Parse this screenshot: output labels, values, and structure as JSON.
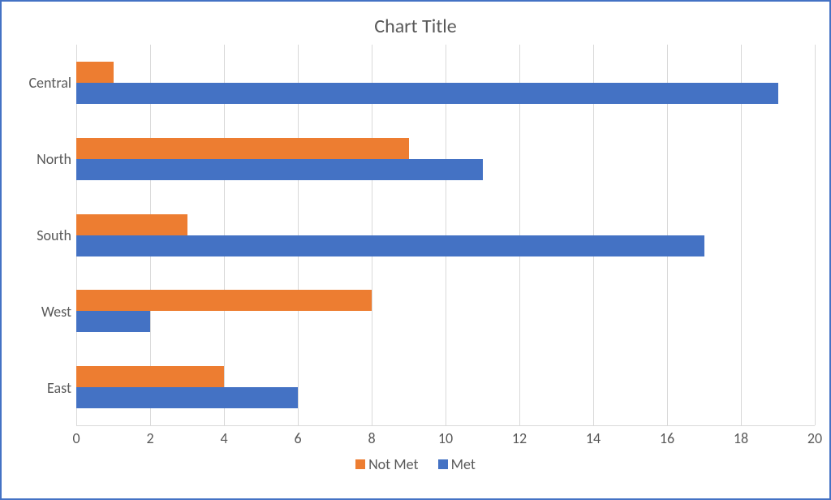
{
  "chart_data": {
    "type": "bar",
    "orientation": "horizontal",
    "title": "Chart Title",
    "categories": [
      "Central",
      "North",
      "South",
      "West",
      "East"
    ],
    "series": [
      {
        "name": "Not Met",
        "values": [
          1,
          9,
          3,
          8,
          4
        ],
        "color": "#ed7d31"
      },
      {
        "name": "Met",
        "values": [
          19,
          11,
          17,
          2,
          6
        ],
        "color": "#4472c4"
      }
    ],
    "xlabel": "",
    "ylabel": "",
    "xlim": [
      0,
      20
    ],
    "x_ticks": [
      0,
      2,
      4,
      6,
      8,
      10,
      12,
      14,
      16,
      18,
      20
    ],
    "grid": true,
    "legend_position": "bottom"
  },
  "legend": {
    "notmet_label": "Not Met",
    "met_label": "Met"
  }
}
